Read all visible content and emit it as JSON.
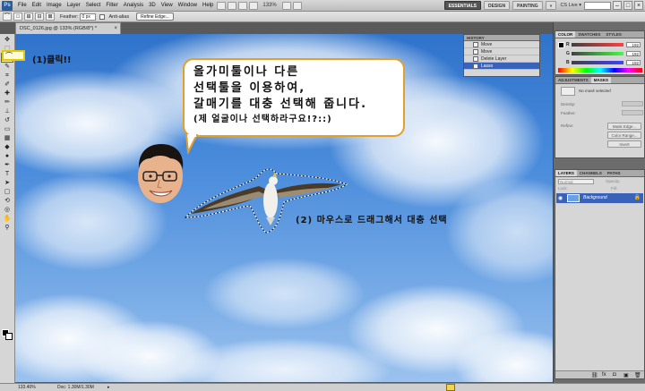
{
  "menu": {
    "logo": "Ps",
    "items": [
      "File",
      "Edit",
      "Image",
      "Layer",
      "Select",
      "Filter",
      "Analysis",
      "3D",
      "View",
      "Window",
      "Help"
    ],
    "zoom": "133%",
    "workspaces": [
      "ESSENTIALS",
      "DESIGN",
      "PAINTING"
    ],
    "more": "»",
    "cslive": "CS Live ▾"
  },
  "options": {
    "feather_label": "Feather:",
    "feather_value": "0 px",
    "antialias_label": "Anti-alias",
    "refine_label": "Refine Edge..."
  },
  "document": {
    "tab_title": "DSC_0126.jpg @ 133% (RGB/8*) *",
    "close": "×"
  },
  "status": {
    "zoom": "133.40%",
    "doc": "Doc: 1.30M/1.30M",
    "arrow": "▸"
  },
  "history": {
    "title": "HISTORY",
    "items": [
      "Move",
      "Move",
      "Delete Layer",
      "Lasso"
    ],
    "current_index": 3
  },
  "color_panel": {
    "tabs": [
      "COLOR",
      "SWATCHES",
      "STYLES"
    ],
    "r": "192",
    "g": "192",
    "b": "192"
  },
  "adjust_panel": {
    "tabs": [
      "ADJUSTMENTS",
      "MASKS"
    ],
    "no_mask": "No mask selected",
    "density": "Density:",
    "feather": "Feather:",
    "refine": "Refine:",
    "mask_edge": "Mask Edge...",
    "color_range": "Color Range...",
    "invert": "Invert"
  },
  "layers_panel": {
    "tabs": [
      "LAYERS",
      "CHANNELS",
      "PATHS"
    ],
    "blend": "Normal",
    "opacity": "Opacity:",
    "lock": "Lock:",
    "fill": "Fill:",
    "layer_name": "Background"
  },
  "annotations": {
    "step1": "(1)클릭!!",
    "bubble": [
      "올가미툴이나 다른",
      "선택툴을 이용하여,",
      "갈매기를 대충 선택해 줍니다.",
      "(제 얼굴이나 선택하라구요!?::)"
    ],
    "step2": "(2) 마우스로 드래그해서 대충 선택"
  },
  "colors": {
    "sky": "#4c8ddc",
    "highlight": "#e7c700",
    "bubble_border": "#e2a028",
    "selected": "#3a62b8"
  }
}
